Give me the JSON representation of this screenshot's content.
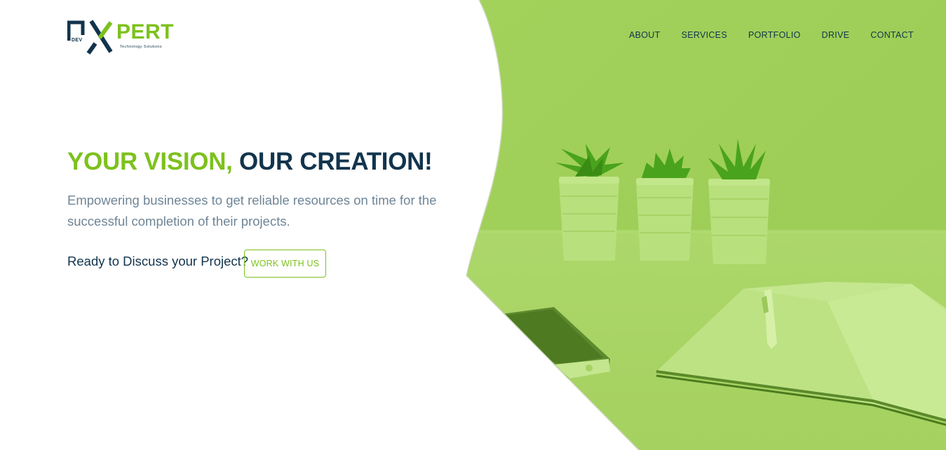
{
  "brand": {
    "logo_mark": "NX",
    "logo_pert": "PERT",
    "logo_dev": "DEV",
    "tagline": "Technology Solutions"
  },
  "nav": {
    "items": [
      {
        "label": "ABOUT"
      },
      {
        "label": "SERVICES"
      },
      {
        "label": "PORTFOLIO"
      },
      {
        "label": "DRIVE"
      },
      {
        "label": "CONTACT"
      }
    ]
  },
  "hero": {
    "headline_green": "YOUR VISION,",
    "headline_navy": "OUR CREATION!",
    "subtext": "Empowering businesses to get reliable resources on time for the successful completion of their projects.",
    "cta_text": "Ready to Discuss your Project?",
    "cta_button": "WORK WITH US"
  },
  "colors": {
    "accent_green": "#7dc11d",
    "navy": "#12344d",
    "muted_text": "#6f8596",
    "image_tint": "#a4d15a"
  },
  "image": {
    "subject": "hero-photo-plants-notebook-phone"
  }
}
